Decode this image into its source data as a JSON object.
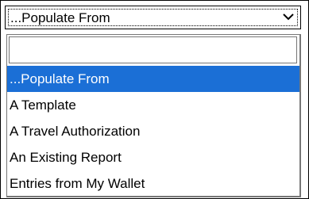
{
  "select": {
    "value": "...Populate From",
    "chevron_icon": "chevron-down-icon"
  },
  "dropdown": {
    "filter_value": "",
    "options": [
      {
        "label": "...Populate From",
        "selected": true
      },
      {
        "label": "A Template",
        "selected": false
      },
      {
        "label": "A Travel Authorization",
        "selected": false
      },
      {
        "label": "An Existing Report",
        "selected": false
      },
      {
        "label": "Entries from My Wallet",
        "selected": false
      }
    ]
  },
  "colors": {
    "highlight": "#1b6fd6",
    "border": "#767676"
  }
}
